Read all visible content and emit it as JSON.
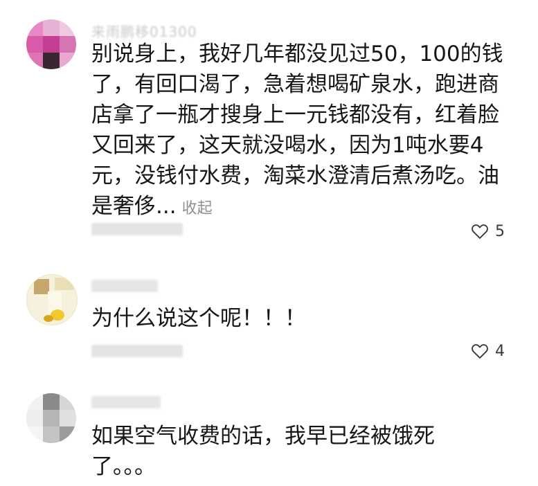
{
  "comments": [
    {
      "username": "来雨鹏移01300",
      "text": "别说身上，我好几年都没见过50，100的钱\n了，有回口渴了，急着想喝矿泉水，跑进商\n店拿了一瓶才搜身上一元钱都没有，红着脸\n又回来了，这天就没喝水，因为1吨水要4\n元，没钱付水费，淘菜水澄清后煮汤吃。油\n是奢侈...",
      "collapse_label": "收起",
      "likes": "5",
      "icons": [
        "pixelated-avatar",
        "heart-icon"
      ]
    },
    {
      "username": "",
      "text": "为什么说这个呢！！！",
      "likes": "4",
      "icons": [
        "avatar",
        "heart-icon"
      ]
    },
    {
      "username": "",
      "text": "如果空气收费的话，我早已经被饿死\n了。。。",
      "icons": [
        "pixelated-avatar"
      ]
    }
  ]
}
